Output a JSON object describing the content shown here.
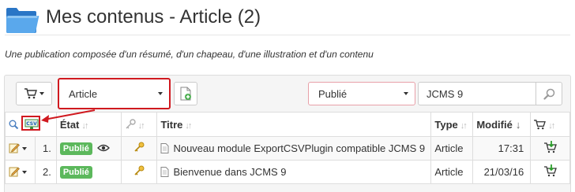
{
  "header": {
    "title": "Mes contenus - Article (2)",
    "folder_icon": "folder-icon"
  },
  "description": "Une publication composée d'un résumé, d'un chapeau, d'une illustration et d'un contenu",
  "toolbar": {
    "cart_icon": "cart-icon",
    "type_select": {
      "value": "Article"
    },
    "add_document_icon": "add-document-icon",
    "status_select": {
      "value": "Publié"
    },
    "search": {
      "value": "JCMS 9"
    },
    "search_icon": "search-icon"
  },
  "table": {
    "columns": {
      "etat": "État",
      "titre": "Titre",
      "type": "Type",
      "modifie": "Modifié"
    },
    "header_icons": [
      "zoom-icon",
      "csv-export-icon",
      "key-icon",
      "cart-icon"
    ],
    "rows": [
      {
        "num": "1.",
        "status": "Publié",
        "title": "Nouveau module ExportCSVPlugin compatible JCMS 9",
        "type": "Article",
        "modified": "17:31"
      },
      {
        "num": "2.",
        "status": "Publié",
        "title": "Bienvenue dans JCMS 9",
        "type": "Article",
        "modified": "21/03/16"
      }
    ]
  },
  "colors": {
    "highlight_red": "#d0191f",
    "badge_green": "#5cb85c",
    "panel_bg": "#f5f5f5"
  }
}
